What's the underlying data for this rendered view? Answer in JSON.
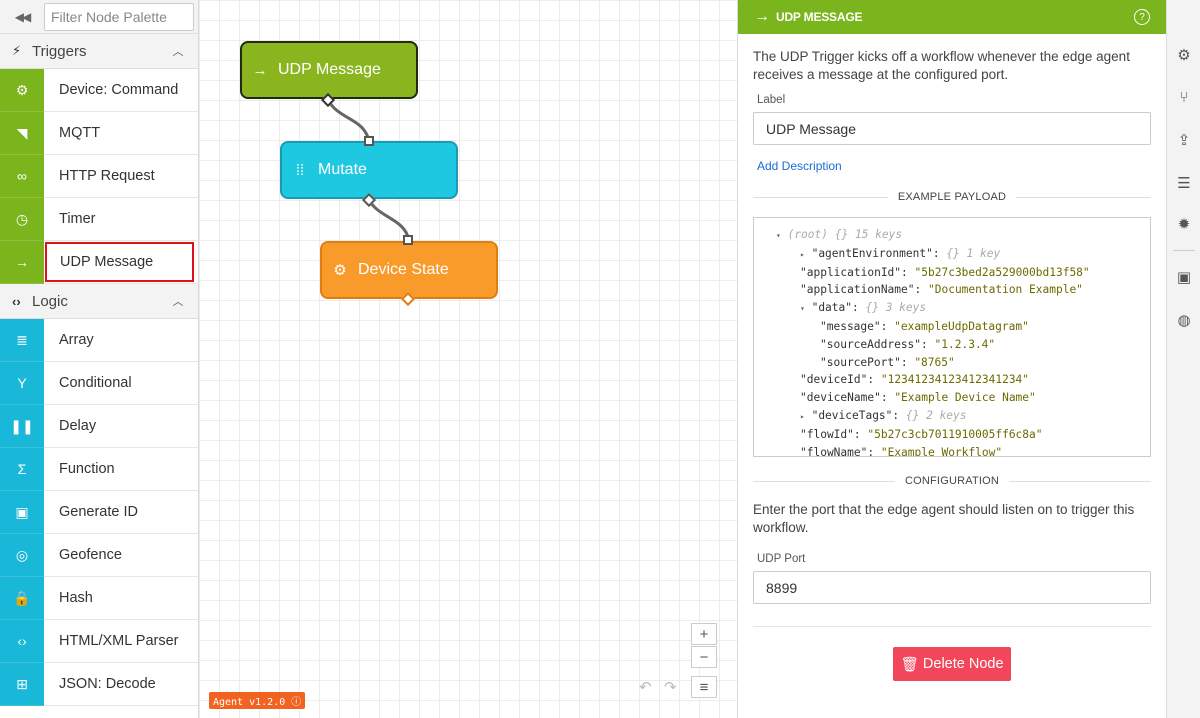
{
  "palette": {
    "collapse_icon": "double-chevron-left-icon",
    "filter_placeholder": "Filter Node Palette",
    "categories": [
      {
        "label": "Triggers",
        "icon": "bolt-icon",
        "color": "#7ab51d",
        "items": [
          {
            "label": "Device: Command",
            "icon": "chip-icon"
          },
          {
            "label": "MQTT",
            "icon": "cast-icon"
          },
          {
            "label": "HTTP Request",
            "icon": "link-icon"
          },
          {
            "label": "Timer",
            "icon": "stopwatch-icon"
          },
          {
            "label": "UDP Message",
            "icon": "arrow-right-icon",
            "selected": true
          }
        ]
      },
      {
        "label": "Logic",
        "icon": "code-icon",
        "color": "#1ab8d8",
        "items": [
          {
            "label": "Array",
            "icon": "list-icon"
          },
          {
            "label": "Conditional",
            "icon": "fork-icon"
          },
          {
            "label": "Delay",
            "icon": "pause-icon"
          },
          {
            "label": "Function",
            "icon": "sigma-icon"
          },
          {
            "label": "Generate ID",
            "icon": "id-card-icon"
          },
          {
            "label": "Geofence",
            "icon": "target-icon"
          },
          {
            "label": "Hash",
            "icon": "lock-icon"
          },
          {
            "label": "HTML/XML Parser",
            "icon": "code-icon"
          },
          {
            "label": "JSON: Decode",
            "icon": "json-icon"
          }
        ]
      }
    ]
  },
  "canvas": {
    "nodes": [
      {
        "label": "UDP Message",
        "color": "#8ab51e",
        "border": "#1f2a10",
        "icon": "arrow-right-icon"
      },
      {
        "label": "Mutate",
        "color": "#1ec8e0",
        "border": "#1b9ab5",
        "icon": "grid-dots-icon"
      },
      {
        "label": "Device State",
        "color": "#f99b2a",
        "border": "#e07d10",
        "icon": "chip-icon"
      }
    ],
    "version_label": "Agent v1.2.0 ⓘ",
    "zoom_in": "+",
    "zoom_out": "−",
    "menu_icon": "≡",
    "undo_icon": "↶",
    "redo_icon": "↷"
  },
  "panel": {
    "title": "UDP MESSAGE",
    "header_color": "#7ab51d",
    "help": "?",
    "description": "The UDP Trigger kicks off a workflow whenever the edge agent receives a message at the configured port.",
    "label_caption": "Label",
    "label_value": "UDP Message",
    "add_description": "Add Description",
    "example_payload_title": "EXAMPLE PAYLOAD",
    "payload_lines": [
      {
        "tri": "▾",
        "key": "(root)",
        "meta": "{} 15 keys",
        "value": "",
        "root": true
      },
      {
        "tri": "▸",
        "key": "\"agentEnvironment\":",
        "meta": "{} 1 key",
        "value": ""
      },
      {
        "tri": "",
        "key": "\"applicationId\":",
        "meta": "",
        "value": "\"5b27c3bed2a529000bd13f58\""
      },
      {
        "tri": "",
        "key": "\"applicationName\":",
        "meta": "",
        "value": "\"Documentation Example\""
      },
      {
        "tri": "▾",
        "key": "\"data\":",
        "meta": "{} 3 keys",
        "value": ""
      },
      {
        "tri": "",
        "key": "\"message\":",
        "meta": "",
        "value": "\"exampleUdpDatagram\"",
        "indent": 2
      },
      {
        "tri": "",
        "key": "\"sourceAddress\":",
        "meta": "",
        "value": "\"1.2.3.4\"",
        "indent": 2
      },
      {
        "tri": "",
        "key": "\"sourcePort\":",
        "meta": "",
        "value": "\"8765\"",
        "indent": 2
      },
      {
        "tri": "",
        "key": "\"deviceId\":",
        "meta": "",
        "value": "\"12341234123412341234\""
      },
      {
        "tri": "",
        "key": "\"deviceName\":",
        "meta": "",
        "value": "\"Example Device Name\""
      },
      {
        "tri": "▸",
        "key": "\"deviceTags\":",
        "meta": "{} 2 keys",
        "value": ""
      },
      {
        "tri": "",
        "key": "\"flowId\":",
        "meta": "",
        "value": "\"5b27c3cb7011910005ff6c8a\""
      },
      {
        "tri": "",
        "key": "\"flowName\":",
        "meta": "",
        "value": "\"Example Workflow\""
      }
    ],
    "configuration_title": "CONFIGURATION",
    "configuration_text": "Enter the port that the edge agent should listen on to trigger this workflow.",
    "port_caption": "UDP Port",
    "port_value": "8899",
    "delete_label": "Delete Node",
    "delete_color": "#f2465b"
  },
  "strip": {
    "icons": [
      "gear-icon",
      "branch-icon",
      "upload-icon",
      "database-icon",
      "bug-icon",
      "device-icon",
      "globe-icon"
    ]
  }
}
